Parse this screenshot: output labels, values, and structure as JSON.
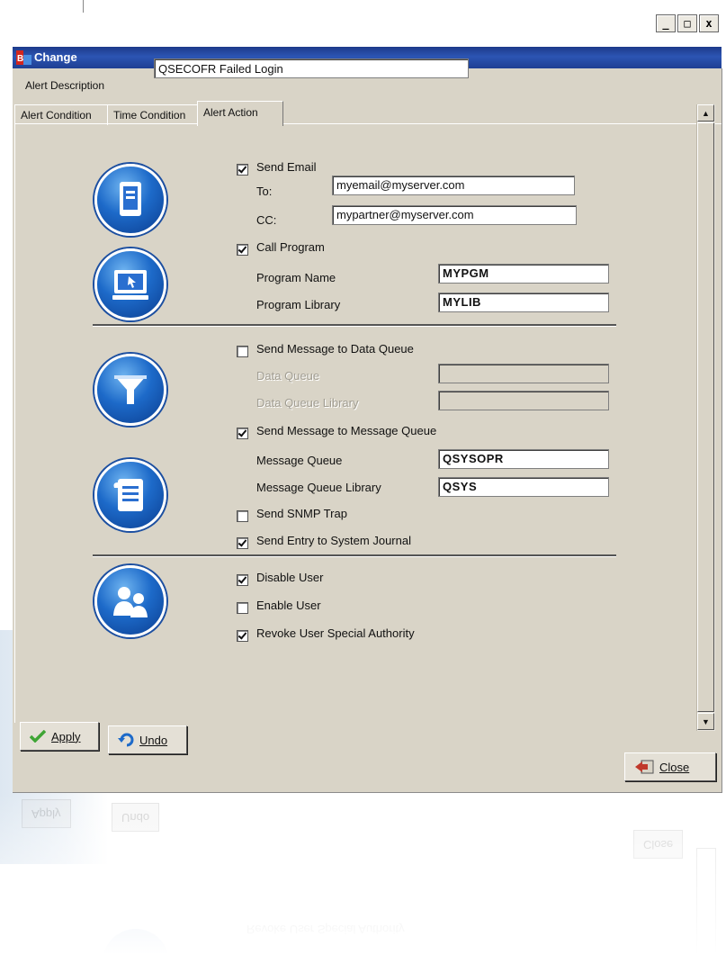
{
  "window": {
    "title": "Change",
    "controls": {
      "minimize": "_",
      "maximize": "□",
      "close": "x"
    }
  },
  "alert_description": {
    "label": "Alert Description",
    "value": "QSECOFR Failed Login"
  },
  "tabs": [
    {
      "label": "Alert Condition",
      "active": false
    },
    {
      "label": "Time Condition",
      "active": false
    },
    {
      "label": "Alert Action",
      "active": true
    }
  ],
  "actions": {
    "send_email": {
      "label": "Send Email",
      "checked": true,
      "to_label": "To:",
      "to_value": "myemail@myserver.com",
      "cc_label": "CC:",
      "cc_value": "mypartner@myserver.com"
    },
    "call_program": {
      "label": "Call Program",
      "checked": true,
      "program_name_label": "Program Name",
      "program_name_value": "MYPGM",
      "program_library_label": "Program Library",
      "program_library_value": "MYLIB"
    },
    "data_queue": {
      "label": "Send Message to Data Queue",
      "checked": false,
      "queue_label": "Data Queue",
      "queue_value": "",
      "library_label": "Data Queue Library",
      "library_value": ""
    },
    "message_queue": {
      "label": "Send Message to Message Queue",
      "checked": true,
      "queue_label": "Message Queue",
      "queue_value": "QSYSOPR",
      "library_label": "Message Queue Library",
      "library_value": "QSYS"
    },
    "snmp_trap": {
      "label": "Send SNMP Trap",
      "checked": false
    },
    "system_journal": {
      "label": "Send Entry to System Journal",
      "checked": true
    },
    "disable_user": {
      "label": "Disable User",
      "checked": true
    },
    "enable_user": {
      "label": "Enable User",
      "checked": false
    },
    "revoke_authority": {
      "label": "Revoke User Special Authority",
      "checked": true
    }
  },
  "buttons": {
    "apply": "Apply",
    "undo": "Undo",
    "close": "Close"
  },
  "colors": {
    "titlebar": "#2c55b3",
    "window_bg": "#d9d4c7",
    "icon_blue": "#1d6ac9",
    "apply_icon": "#3fa535",
    "close_icon": "#c0392b"
  },
  "icons": [
    "email-icon",
    "program-icon",
    "filter-icon",
    "message-queue-icon",
    "users-icon"
  ]
}
